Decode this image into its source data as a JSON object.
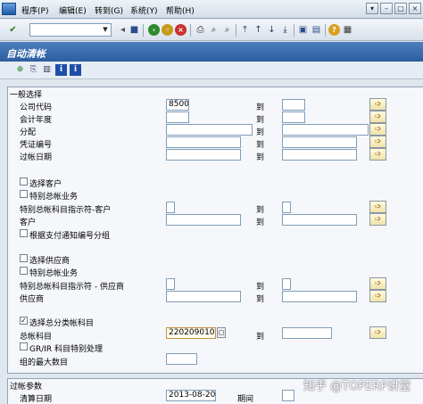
{
  "menubar": {
    "items": [
      "程序(P)",
      "编辑(E)",
      "转到(G)",
      "系统(Y)",
      "帮助(H)"
    ]
  },
  "toolbar": {
    "command_value": ""
  },
  "screen": {
    "title": "自动清帐"
  },
  "general": {
    "title": "一般选择",
    "to_label": "到",
    "rows": {
      "company_code": {
        "label": "公司代码",
        "value": "8500"
      },
      "fiscal_year": {
        "label": "会计年度",
        "value": ""
      },
      "assignment": {
        "label": "分配",
        "value": ""
      },
      "document_number": {
        "label": "凭证编号",
        "value": ""
      },
      "posting_date": {
        "label": "过帐日期",
        "value": ""
      },
      "select_customers": {
        "label": "选择客户"
      },
      "special_gl_customer": {
        "label": "特别总帐业务"
      },
      "special_gl_ind_customer": {
        "label": "特别总帐科目指示符-客户"
      },
      "customer": {
        "label": "客户"
      },
      "group_by_payment_advice": {
        "label": "根据支付通知编号分组"
      },
      "select_vendors": {
        "label": "选择供应商"
      },
      "special_gl_vendor": {
        "label": "特别总帐业务"
      },
      "special_gl_ind_vendor": {
        "label": "特别总帐科目指示符 - 供应商"
      },
      "vendor": {
        "label": "供应商"
      },
      "select_gl_accounts": {
        "label": "选择总分类帐科目",
        "checked_mark": "✓"
      },
      "gl_account": {
        "label": "总帐科目",
        "value": "2202090100"
      },
      "grir_special": {
        "label": "GR/IR 科目特别处理"
      },
      "max_groups": {
        "label": "组的最大数目",
        "value": ""
      }
    }
  },
  "posting_params": {
    "title": "过帐参数",
    "clearing_date": {
      "label": "清算日期",
      "value": "2013-08-20"
    },
    "period": {
      "label": "期间",
      "value": ""
    }
  },
  "watermark": "知乎 @TOPERP讲堂",
  "colors": {
    "title_bar": "#3a6bad",
    "group_border": "#8fa2b8"
  }
}
